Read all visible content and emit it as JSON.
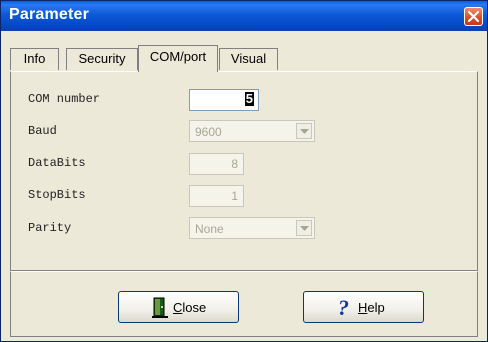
{
  "window": {
    "title": "Parameter"
  },
  "tabs": [
    {
      "label": "Info",
      "active": false
    },
    {
      "label": "Security",
      "active": false
    },
    {
      "label": "COM/port",
      "active": true
    },
    {
      "label": "Visual",
      "active": false
    }
  ],
  "form": {
    "com_number": {
      "label": "COM number",
      "value": "5"
    },
    "baud": {
      "label": "Baud",
      "value": "9600"
    },
    "databits": {
      "label": "DataBits",
      "value": "8"
    },
    "stopbits": {
      "label": "StopBits",
      "value": "1"
    },
    "parity": {
      "label": "Parity",
      "value": "None"
    }
  },
  "buttons": {
    "close": {
      "accel": "C",
      "rest": "lose"
    },
    "help": {
      "accel": "H",
      "rest": "elp"
    }
  },
  "icons": {
    "close": "door-icon",
    "help": "question-mark-icon",
    "title_close": "close-icon"
  }
}
